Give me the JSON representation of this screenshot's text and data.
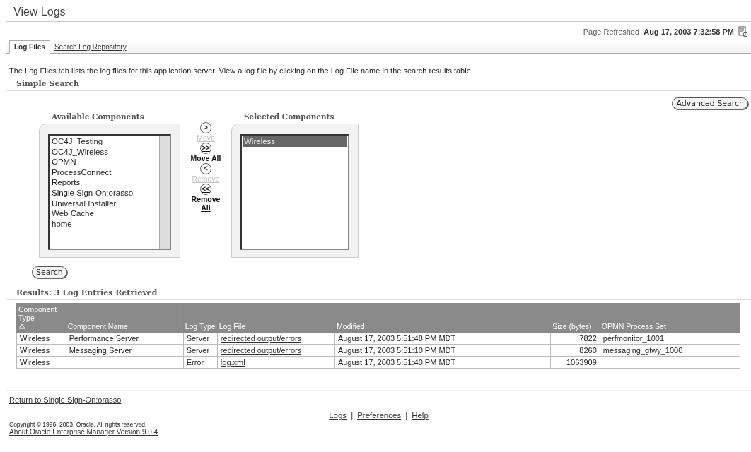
{
  "page": {
    "title": "View Logs",
    "refreshed_label": "Page Refreshed",
    "refreshed_value": "Aug 17, 2003 7:32:58 PM"
  },
  "tabs": [
    {
      "label": "Log Files",
      "selected": true
    },
    {
      "label": "Search Log Repository",
      "selected": false
    }
  ],
  "description": "The Log Files tab lists the log files for this application server. View a log file by clicking on the Log File name in the search results table.",
  "search": {
    "heading": "Simple Search",
    "advanced_button": "Advanced Search",
    "search_button": "Search",
    "available": {
      "label": "Available Components",
      "items": [
        {
          "label": "OC4J_Testing",
          "selected": false
        },
        {
          "label": "OC4J_Wireless",
          "selected": false
        },
        {
          "label": "OPMN",
          "selected": false
        },
        {
          "label": "ProcessConnect",
          "selected": false
        },
        {
          "label": "Reports",
          "selected": false
        },
        {
          "label": "Single Sign-On:orasso",
          "selected": false
        },
        {
          "label": "Universal Installer",
          "selected": false
        },
        {
          "label": "Web Cache",
          "selected": false
        },
        {
          "label": "home",
          "selected": false
        }
      ]
    },
    "selected": {
      "label": "Selected Components",
      "items": [
        {
          "label": "Wireless",
          "selected": true
        }
      ]
    },
    "shuttle": [
      {
        "glyph": ">",
        "label": "Move",
        "disabled": true
      },
      {
        "glyph": ">>",
        "label": "Move All",
        "disabled": false
      },
      {
        "glyph": "<",
        "label": "Remove",
        "disabled": true
      },
      {
        "glyph": "<<",
        "label": "Remove All",
        "disabled": false
      }
    ]
  },
  "results": {
    "heading": "Results: 3 Log Entries Retrieved",
    "columns": [
      {
        "label": "Component Type",
        "sorted": true
      },
      {
        "label": "Component Name",
        "sorted": false
      },
      {
        "label": "Log Type",
        "sorted": false
      },
      {
        "label": "Log File",
        "sorted": false
      },
      {
        "label": "Modified",
        "sorted": false
      },
      {
        "label": "Size (bytes)",
        "sorted": false
      },
      {
        "label": "OPMN Process Set",
        "sorted": false
      }
    ],
    "rows": [
      [
        "Wireless",
        "Performance Server",
        "Server",
        "redirected output/errors",
        "August 17, 2003 5:51:48 PM MDT",
        "7822",
        "perfmonitor_1001"
      ],
      [
        "Wireless",
        "Messaging Server",
        "Server",
        "redirected output/errors",
        "August 17, 2003 5:51:10 PM MDT",
        "8260",
        "messaging_gtwy_1000"
      ],
      [
        "Wireless",
        "",
        "Error",
        "log.xml",
        "August 17, 2003 5:51:40 PM MDT",
        "1063909",
        ""
      ]
    ]
  },
  "return_link": "Return to Single Sign-On:orasso",
  "footer_links": [
    "Logs",
    "Preferences",
    "Help"
  ],
  "footer_separator": "|",
  "copyright": "Copyright © 1996, 2003, Oracle. All rights reserved.",
  "about_link": "About Oracle Enterprise Manager Version 9.0.4"
}
